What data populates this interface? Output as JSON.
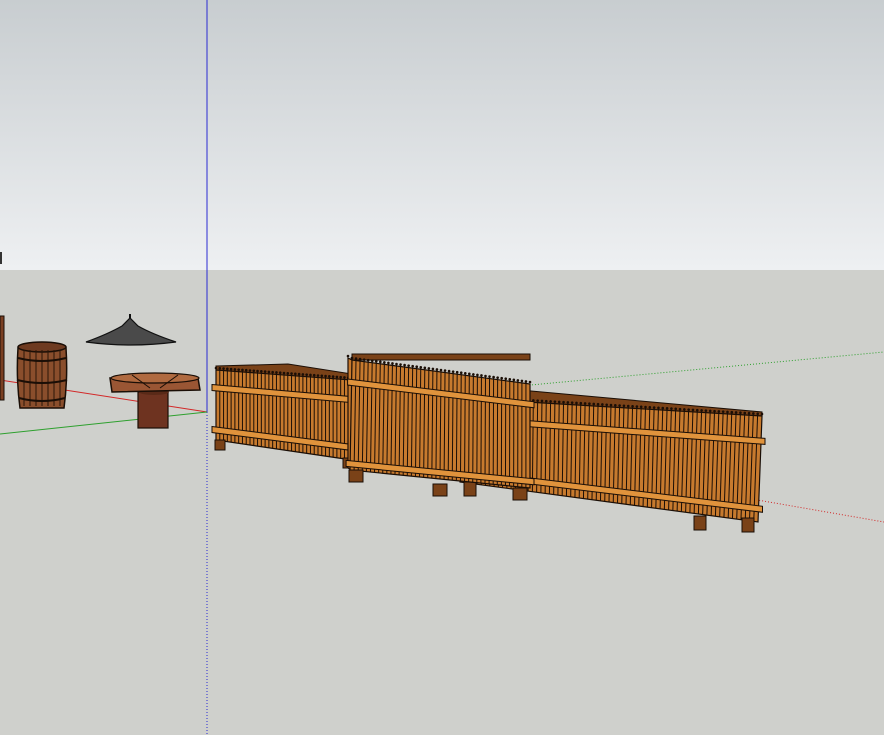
{
  "app": {
    "kind": "3D modeling viewport"
  },
  "colors": {
    "sky_top": "#c8cdd0",
    "sky_bottom": "#eef0f2",
    "ground": "#cfd0cc",
    "wood_light": "#e0933c",
    "wood_mid": "#c77a2e",
    "wood_dark": "#7a4218",
    "barrel": "#8a4e2c",
    "table_top": "#9a5634",
    "table_leg": "#6e3320",
    "umbrella": "#4a4a4a",
    "outline": "#1a0e06",
    "axis_red": "#d22828",
    "axis_green": "#2ea02e",
    "axis_blue": "#2a2ad2"
  },
  "scene": {
    "axes": [
      "red-axis",
      "green-axis",
      "blue-axis"
    ],
    "objects": [
      "barrel",
      "umbrella",
      "round-table",
      "planter-box-left",
      "planter-box-tall",
      "planter-box-right"
    ]
  }
}
